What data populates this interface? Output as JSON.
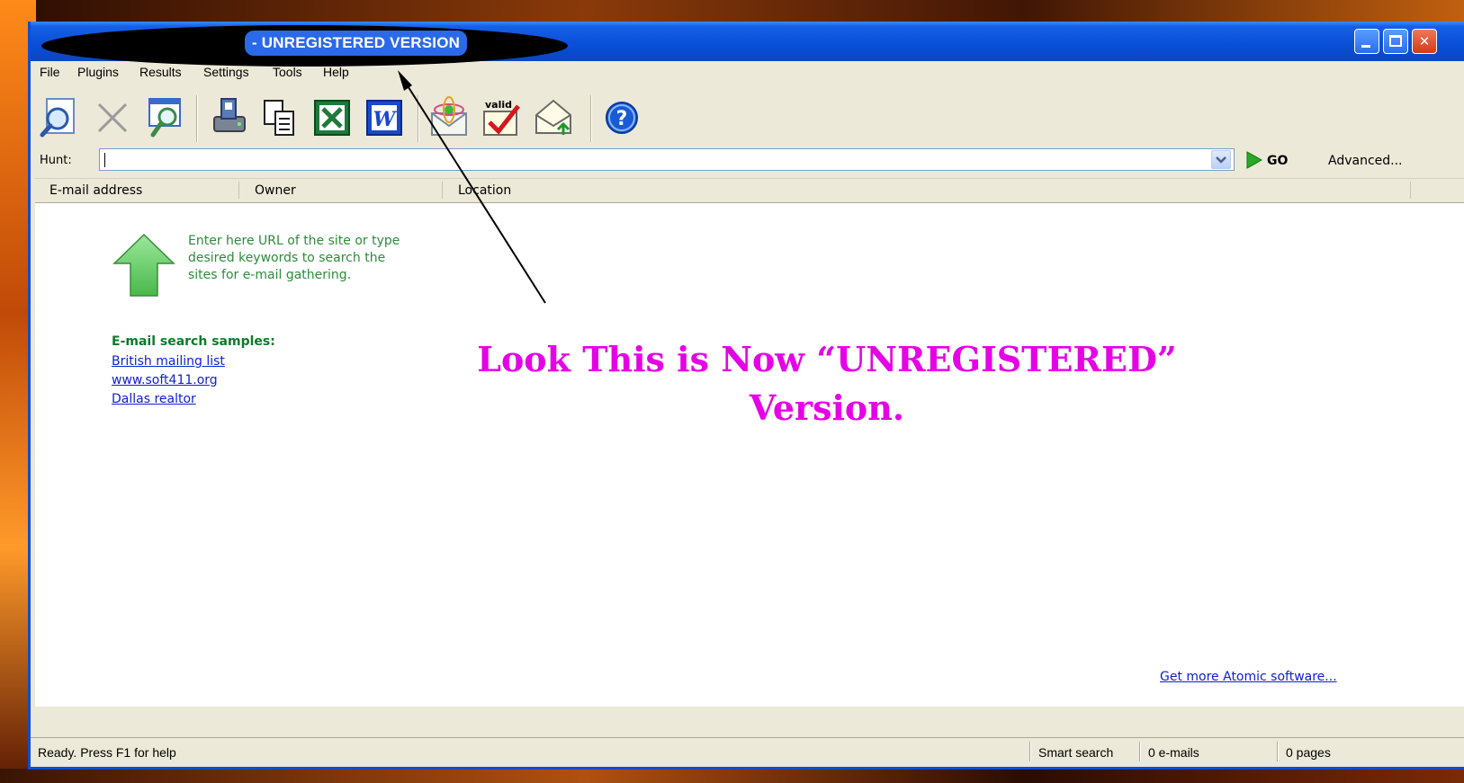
{
  "window": {
    "title": "- UNREGISTERED VERSION"
  },
  "menu": [
    "File",
    "Plugins",
    "Results",
    "Settings",
    "Tools",
    "Help"
  ],
  "toolbar": {
    "icons": [
      "start-search-icon",
      "stop-icon",
      "find-icon",
      "save-icon",
      "copy-icon",
      "excel-export-icon",
      "word-export-icon",
      "atomic-mail-icon",
      "valid-check-icon",
      "mail-exchange-icon",
      "help-icon"
    ]
  },
  "hunt": {
    "label": "Hunt:",
    "value": "",
    "go_label": "GO",
    "advanced_label": "Advanced..."
  },
  "columns": [
    "E-mail address",
    "Owner",
    "Location"
  ],
  "hint": {
    "text": "Enter here URL of the site or type\ndesired keywords to search the\nsites for e-mail gathering."
  },
  "samples": {
    "title": "E-mail search samples:",
    "links": [
      "British mailing list",
      "www.soft411.org",
      "Dallas realtor"
    ]
  },
  "annotation": {
    "line1": "Look This is Now “UNREGISTERED”",
    "line2": "Version."
  },
  "more_link": "Get more Atomic software...",
  "status": {
    "message": "Ready. Press F1 for help",
    "mode": "Smart search",
    "emails": "0 e-mails",
    "pages": "0 pages"
  },
  "colors": {
    "annotation": "#e600e6",
    "hint_green": "#2e8b3a",
    "link_blue": "#1020d0",
    "titlebar_blue": "#0a50d8"
  }
}
